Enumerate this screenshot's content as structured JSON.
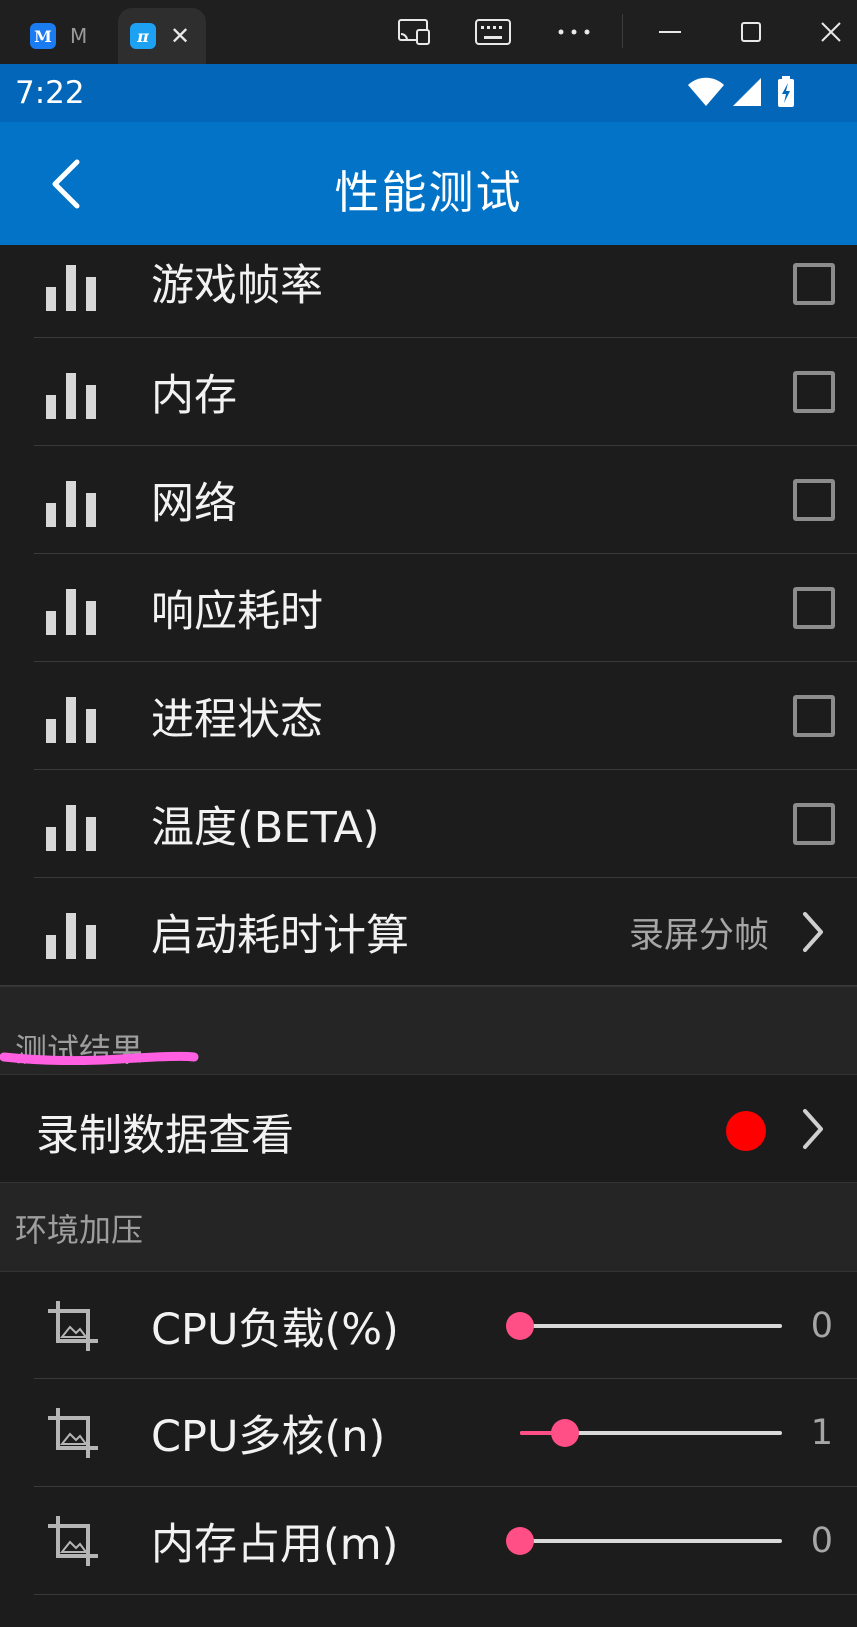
{
  "window": {
    "tabs": [
      {
        "icon": "M",
        "title": "M",
        "active": false
      },
      {
        "icon": "π",
        "active": true
      }
    ],
    "icons": [
      "cast-icon",
      "keyboard-icon",
      "more-icon",
      "minimize-icon",
      "maximize-icon",
      "close-icon"
    ]
  },
  "status_bar": {
    "time": "7:22"
  },
  "app_bar": {
    "title": "性能测试"
  },
  "metrics": [
    {
      "label": "游戏帧率",
      "checked": false
    },
    {
      "label": "内存",
      "checked": false
    },
    {
      "label": "网络",
      "checked": false
    },
    {
      "label": "响应耗时",
      "checked": false
    },
    {
      "label": "进程状态",
      "checked": false
    },
    {
      "label": "温度(BETA)",
      "checked": false
    }
  ],
  "startup": {
    "label": "启动耗时计算",
    "value": "录屏分帧"
  },
  "results_section": {
    "title": "测试结果",
    "record_label": "录制数据查看",
    "record_status_color": "#ff0000"
  },
  "pressure_section": {
    "title": "环境加压",
    "sliders": [
      {
        "label": "CPU负载(%)",
        "value": "0",
        "fraction": 0.0
      },
      {
        "label": "CPU多核(n)",
        "value": "1",
        "fraction": 0.17
      },
      {
        "label": "内存占用(m)",
        "value": "0",
        "fraction": 0.0
      }
    ]
  },
  "colors": {
    "status_bar": "#0366b8",
    "app_bar": "#0273c6",
    "background": "#1c1c1c",
    "slider_accent": "#ff4f86",
    "highlight_stroke": "#ff5fe0"
  }
}
